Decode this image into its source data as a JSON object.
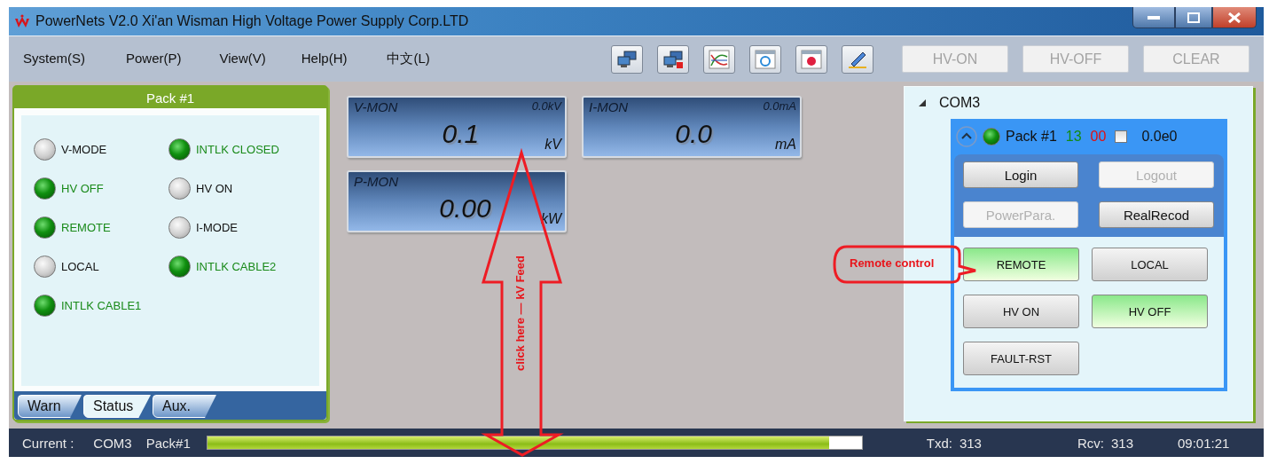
{
  "window": {
    "title": "PowerNets V2.0  Xi'an Wisman High Voltage Power Supply Corp.LTD"
  },
  "menu": [
    "System(S)",
    "Power(P)",
    "View(V)",
    "Help(H)",
    "中文(L)"
  ],
  "toolbar_buttons": [
    {
      "label": "HV-ON",
      "disabled": true
    },
    {
      "label": "HV-OFF",
      "disabled": true
    },
    {
      "label": "CLEAR",
      "disabled": true
    }
  ],
  "status_panel": {
    "title": "Pack #1",
    "indicators": [
      {
        "label": "V-MODE",
        "on": false
      },
      {
        "label": "INTLK CLOSED",
        "on": true
      },
      {
        "label": "HV OFF",
        "on": true
      },
      {
        "label": "HV ON",
        "on": false
      },
      {
        "label": "REMOTE",
        "on": true
      },
      {
        "label": "I-MODE",
        "on": false
      },
      {
        "label": "LOCAL",
        "on": false
      },
      {
        "label": "INTLK CABLE2",
        "on": true
      },
      {
        "label": "INTLK CABLE1",
        "on": true
      }
    ],
    "tabs": [
      {
        "label": "Warn",
        "selected": false
      },
      {
        "label": "Status",
        "selected": true
      },
      {
        "label": "Aux.",
        "selected": false
      }
    ]
  },
  "meters": [
    {
      "name": "V-MON",
      "reading": "0.0kV",
      "value": "0.1",
      "unit": "kV"
    },
    {
      "name": "I-MON",
      "reading": "0.0mA",
      "value": "0.0",
      "unit": "mA"
    },
    {
      "name": "P-MON",
      "value": "0.00",
      "unit": "kW"
    }
  ],
  "device_tree": {
    "port": "COM3",
    "expanded": true,
    "pack": {
      "name": "Pack #1",
      "online": true,
      "count_ok": "13",
      "count_err": "00",
      "checked": false,
      "reading": "0.0e0",
      "session_buttons": [
        {
          "label": "Login",
          "disabled": false
        },
        {
          "label": "Logout",
          "disabled": true
        },
        {
          "label": "PowerPara.",
          "disabled": true
        },
        {
          "label": "RealRecod",
          "disabled": false
        }
      ],
      "control_buttons": [
        {
          "label": "REMOTE",
          "active": true
        },
        {
          "label": "LOCAL",
          "active": false
        },
        {
          "label": "HV ON",
          "active": false
        },
        {
          "label": "HV OFF",
          "active": true
        },
        {
          "label": "FAULT-RST",
          "active": false
        }
      ]
    }
  },
  "annotations": [
    {
      "kind": "arrow",
      "text": "click here — kV Feed"
    },
    {
      "kind": "callout",
      "text": "Remote control"
    }
  ],
  "status_bar": {
    "label": "Current :",
    "port": "COM3",
    "pack": "Pack#1",
    "progress": {
      "level": 0.95
    },
    "txd_label": "Txd:",
    "txd": "313",
    "rcv_label": "Rcv:",
    "rcv": "313",
    "time": "09:01:21"
  }
}
